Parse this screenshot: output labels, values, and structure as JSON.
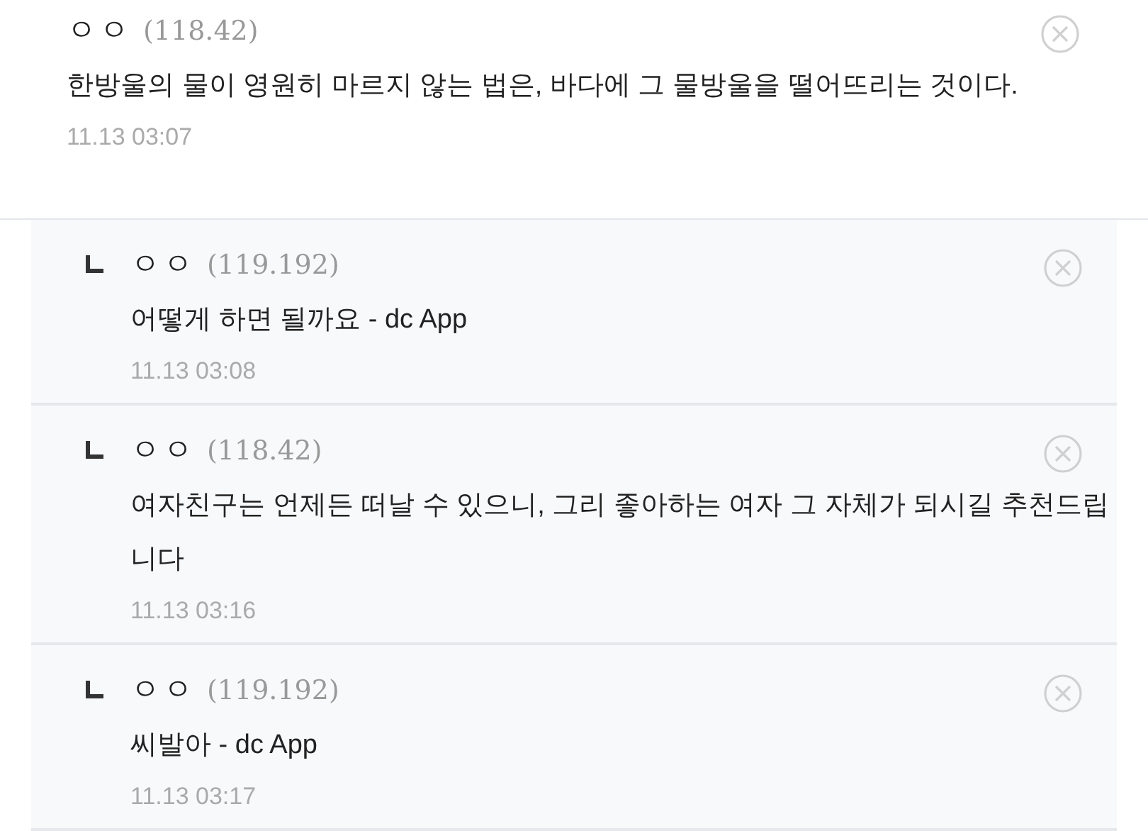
{
  "comment": {
    "nickname": "ㅇㅇ",
    "ip": "(118.42)",
    "text": "한방울의 물이 영원히 마르지 않는 법은, 바다에 그 물방울을 떨어뜨리는 것이다.",
    "time": "11.13 03:07"
  },
  "replies": [
    {
      "nickname": "ㅇㅇ",
      "ip": "(119.192)",
      "text": "어떻게 하면 될까요 - dc App",
      "time": "11.13 03:08"
    },
    {
      "nickname": "ㅇㅇ",
      "ip": "(118.42)",
      "text": "여자친구는 언제든 떠날 수 있으니, 그리 좋아하는 여자 그 자체가 되시길 추천드립니다",
      "time": "11.13 03:16"
    },
    {
      "nickname": "ㅇㅇ",
      "ip": "(119.192)",
      "text": "씨발아 - dc App",
      "time": "11.13 03:17"
    }
  ]
}
